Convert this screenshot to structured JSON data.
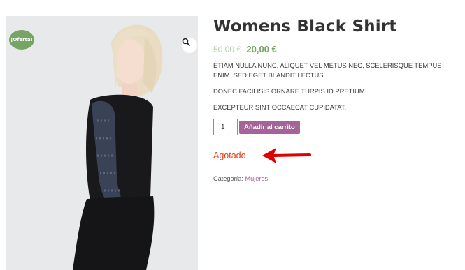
{
  "product": {
    "title": "Womens Black Shirt",
    "sale_badge": "¡Oferta!",
    "price_old": "50,00 €",
    "price_new": "20,00 €",
    "description": [
      "ETIAM NULLA NUNC, ALIQUET VEL METUS NEC, SCELERISQUE TEMPUS ENIM. SED EGET BLANDIT LECTUS.",
      "DONEC FACILISIS ORNARE TURPIS ID PRETIUM.",
      "EXCEPTEUR SINT OCCAECAT CUPIDATAT."
    ],
    "quantity": "1",
    "add_to_cart_label": "Añadir al carrito",
    "stock_status": "Agotado",
    "category_label": "Categoría:",
    "category_value": "Mujeres"
  },
  "icons": {
    "zoom": "magnifier-icon",
    "annotation": "red-arrow-icon"
  },
  "colors": {
    "sale_green": "#77a464",
    "button_purple": "#a46497",
    "out_of_stock_red": "#e2401c",
    "annotation_red": "#e00000"
  }
}
